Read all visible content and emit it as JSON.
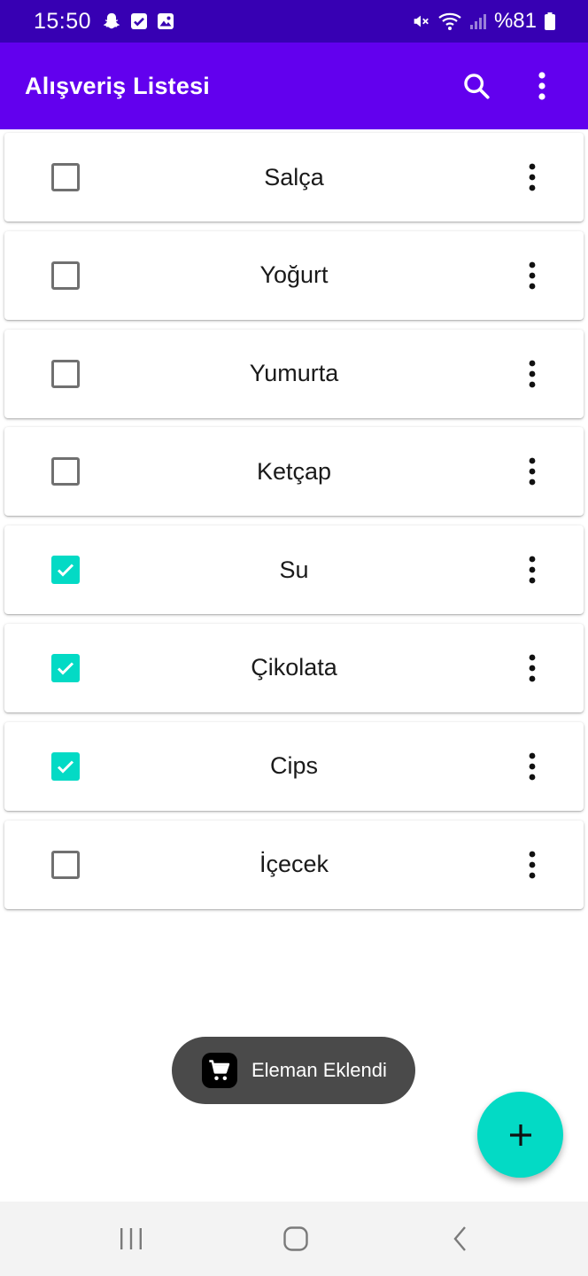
{
  "status_bar": {
    "time": "15:50",
    "battery": "%81",
    "left_icons": [
      "snapchat-icon",
      "checkbox-notification-icon",
      "gallery-icon"
    ],
    "right_icons": [
      "mute-icon",
      "wifi-icon",
      "signal-icon",
      "battery-icon"
    ]
  },
  "app_bar": {
    "title": "Alışveriş Listesi",
    "actions": [
      "search-icon",
      "more-vert-icon"
    ]
  },
  "items": [
    {
      "label": "Salça",
      "checked": false
    },
    {
      "label": "Yoğurt",
      "checked": false
    },
    {
      "label": "Yumurta",
      "checked": false
    },
    {
      "label": "Ketçap",
      "checked": false
    },
    {
      "label": "Su",
      "checked": true
    },
    {
      "label": "Çikolata",
      "checked": true
    },
    {
      "label": "Cips",
      "checked": true
    },
    {
      "label": "İçecek",
      "checked": false
    }
  ],
  "toast": {
    "icon": "shopping-cart-icon",
    "text": "Eleman Eklendi"
  },
  "fab": {
    "icon": "plus-icon"
  },
  "nav_bar": {
    "buttons": [
      "recents-icon",
      "home-icon",
      "back-icon"
    ]
  },
  "colors": {
    "status_bar": "#3700b3",
    "app_bar": "#6200ee",
    "accent": "#03dac5",
    "toast_bg": "#4a4a4a",
    "nav_bar": "#f3f3f3"
  }
}
